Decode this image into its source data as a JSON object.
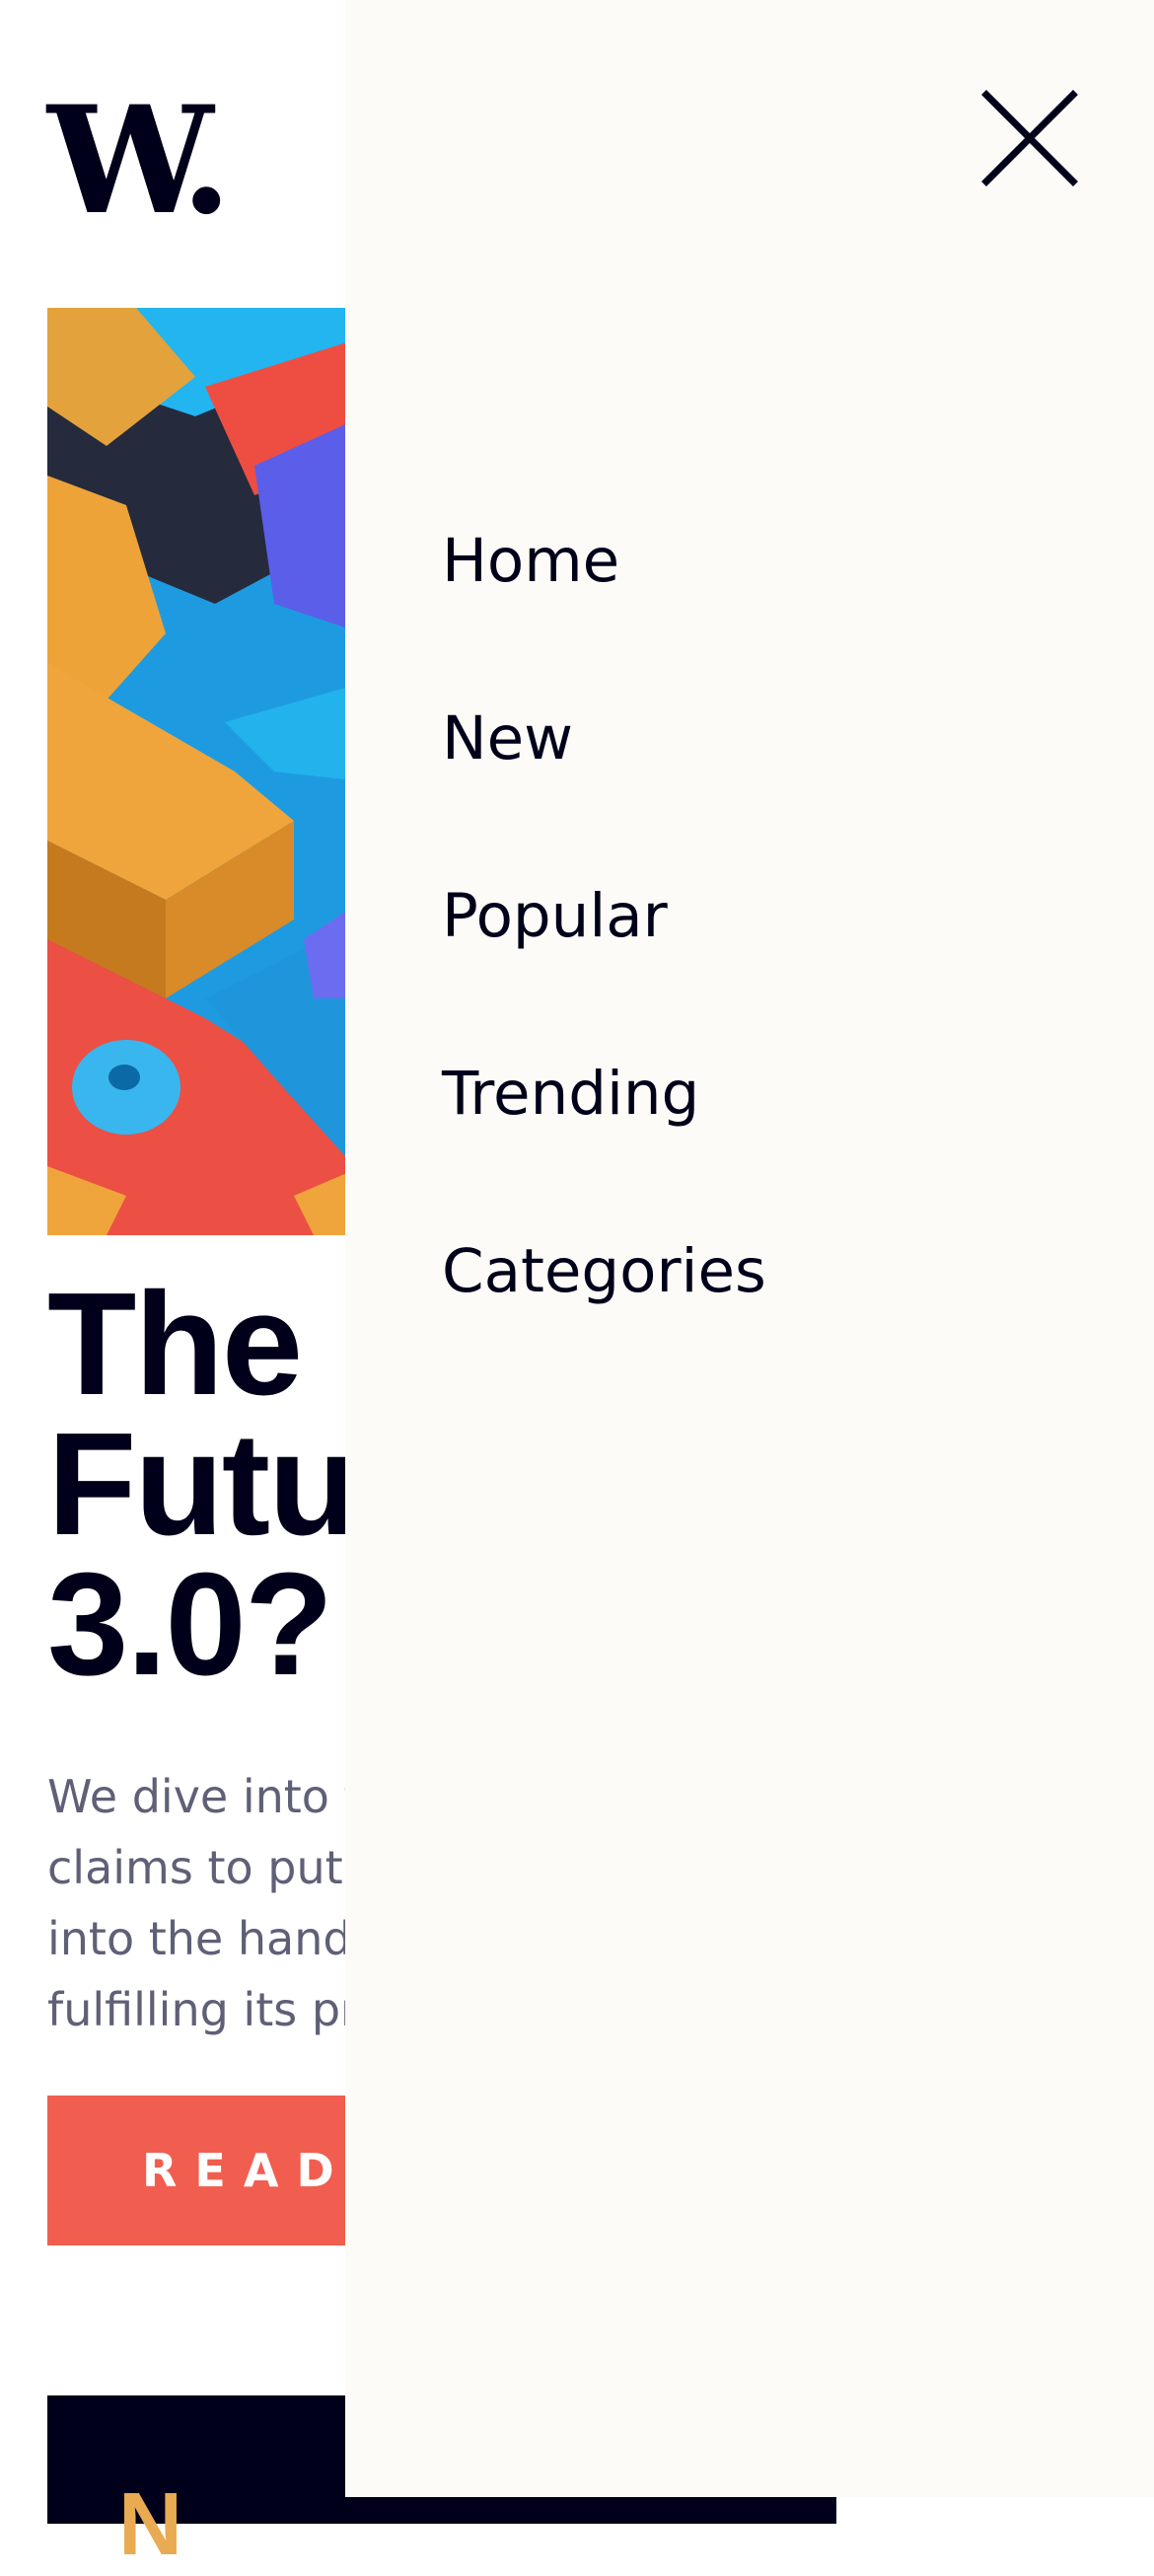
{
  "header": {
    "logo_text": "W."
  },
  "article": {
    "headline_lines": [
      "The Future of Web",
      "3.0?"
    ],
    "headline_visible": [
      "The",
      "Futu",
      "3.0?"
    ],
    "excerpt_lines": [
      "We dive into t",
      "claims to put",
      "into the hand",
      "fulfilling its pr"
    ],
    "read_button_label": "READ",
    "next_section_initial": "N"
  },
  "drawer": {
    "close_icon": "close-icon",
    "nav_items": [
      {
        "label": "Home"
      },
      {
        "label": "New"
      },
      {
        "label": "Popular"
      },
      {
        "label": "Trending"
      },
      {
        "label": "Categories"
      }
    ]
  },
  "colors": {
    "ink": "#00001a",
    "accent_red": "#f15e50",
    "accent_orange": "#e9ab52",
    "drawer_bg": "#fcfbf8",
    "excerpt_gray": "#5f6077"
  }
}
